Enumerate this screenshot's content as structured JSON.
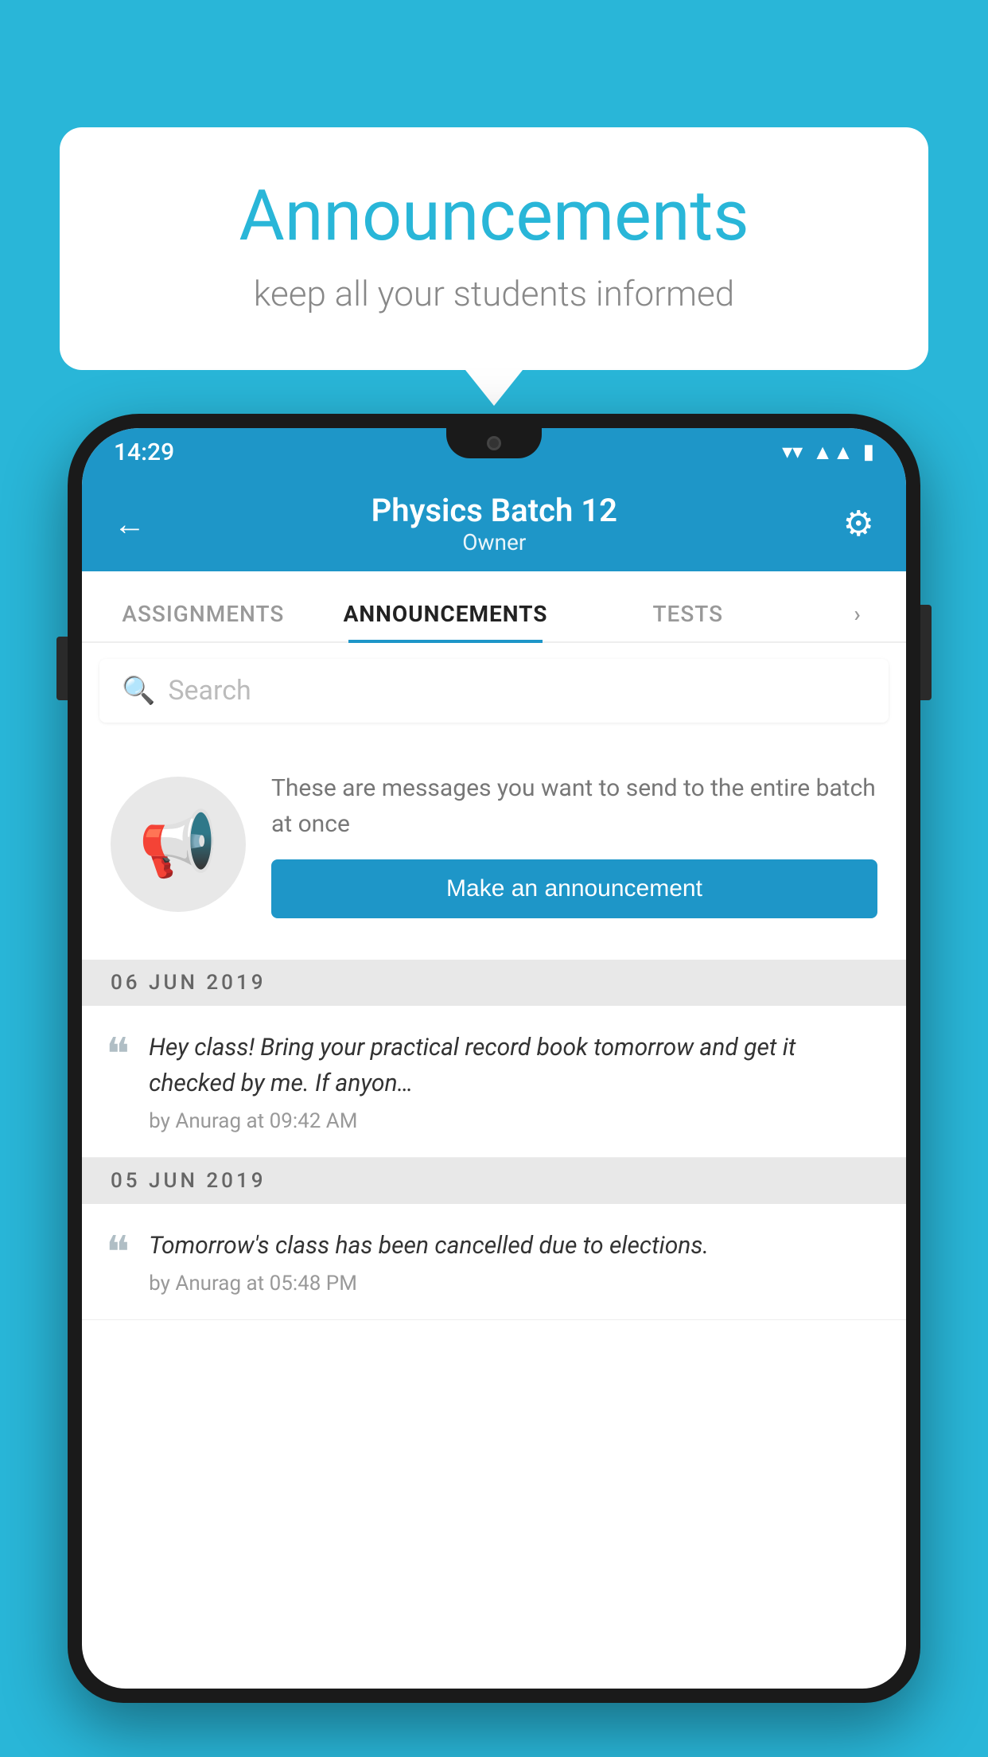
{
  "bubble": {
    "title": "Announcements",
    "subtitle": "keep all your students informed"
  },
  "phone": {
    "statusBar": {
      "time": "14:29",
      "icons": [
        "wifi",
        "signal",
        "battery"
      ]
    },
    "header": {
      "title": "Physics Batch 12",
      "subtitle": "Owner",
      "backLabel": "←",
      "gearLabel": "⚙"
    },
    "tabs": [
      {
        "label": "ASSIGNMENTS",
        "active": false
      },
      {
        "label": "ANNOUNCEMENTS",
        "active": true
      },
      {
        "label": "TESTS",
        "active": false
      },
      {
        "label": "›",
        "active": false,
        "partial": true
      }
    ],
    "search": {
      "placeholder": "Search"
    },
    "announcementPrompt": {
      "descriptionText": "These are messages you want to send to the entire batch at once",
      "buttonLabel": "Make an announcement"
    },
    "announcements": [
      {
        "date": "06  JUN  2019",
        "message": "Hey class! Bring your practical record book tomorrow and get it checked by me. If anyon…",
        "meta": "by Anurag at 09:42 AM"
      },
      {
        "date": "05  JUN  2019",
        "message": "Tomorrow's class has been cancelled due to elections.",
        "meta": "by Anurag at 05:48 PM"
      }
    ]
  }
}
